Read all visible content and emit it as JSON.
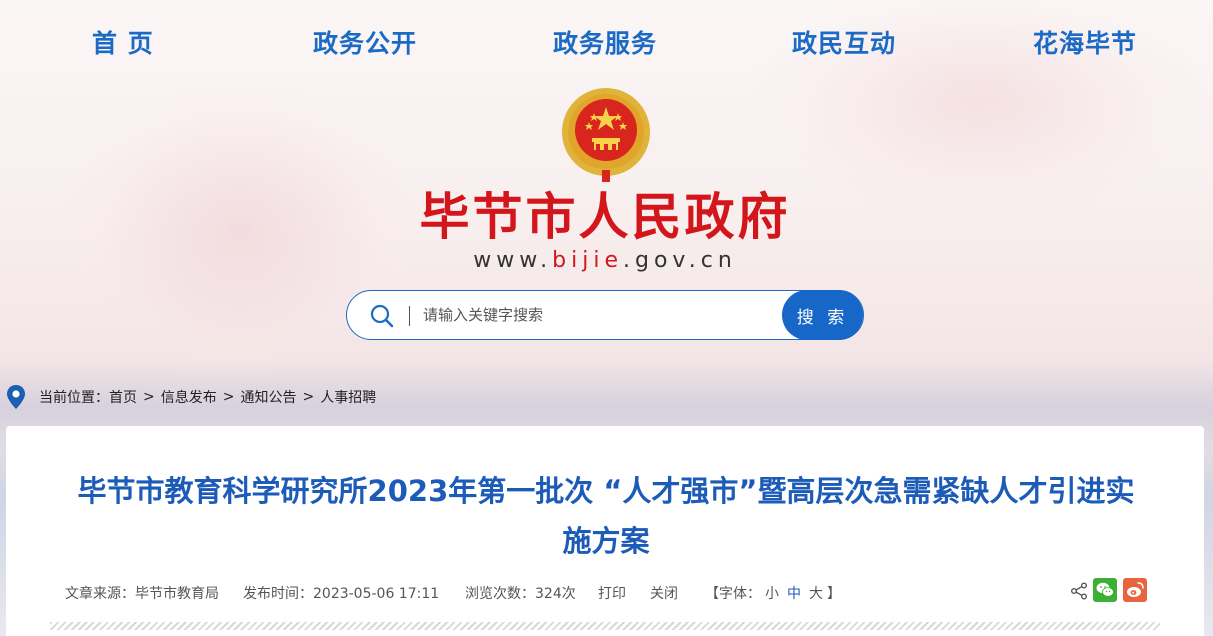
{
  "nav": {
    "items": [
      {
        "label": "首  页"
      },
      {
        "label": "政务公开"
      },
      {
        "label": "政务服务"
      },
      {
        "label": "政民互动"
      },
      {
        "label": "花海毕节"
      }
    ]
  },
  "header": {
    "site_title": "毕节市人民政府",
    "url_prefix": "www.",
    "url_highlight": "bijie",
    "url_suffix": ".gov.cn"
  },
  "search": {
    "placeholder": "请输入关键字搜索",
    "value": "",
    "button_label": "搜 索"
  },
  "breadcrumb": {
    "prefix": "当前位置：",
    "items": [
      "首页",
      "信息发布",
      "通知公告",
      "人事招聘"
    ],
    "separator": ">"
  },
  "article": {
    "title_line1": "毕节市教育科学研究所2023年第一批次 “人才强市”暨高层次急需紧缺人才引进实",
    "title_line2": "施方案",
    "source": "文章来源：毕节市教育局",
    "publish_time": "发布时间：2023-05-06 17:11",
    "views": "浏览次数：324次",
    "print_label": "打印",
    "close_label": "关闭",
    "font_size_prefix": "【字体：",
    "font_small": "小",
    "font_medium": "中",
    "font_large": "大",
    "font_size_suffix": "】"
  },
  "colors": {
    "nav_blue": "#1a6ac6",
    "title_red": "#d3161b",
    "article_title_blue": "#1c5bb8",
    "search_button": "#1667c8",
    "wechat_green": "#3cb034",
    "weibo_orange": "#e8643e"
  },
  "icons": [
    "national-emblem-icon",
    "search-icon",
    "location-pin-icon",
    "share-icon",
    "wechat-icon",
    "weibo-icon"
  ]
}
